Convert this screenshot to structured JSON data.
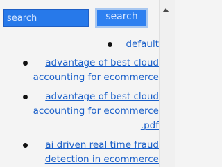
{
  "search": {
    "placeholder": "search",
    "button_label": "search"
  },
  "results": [
    {
      "text": "default"
    },
    {
      "text": "advantage of best cloud accounting for ecommerce"
    },
    {
      "text": "advantage of best cloud accounting for ecommerce .pdf"
    },
    {
      "text": "ai driven real time fraud detection in ecommerce"
    }
  ],
  "colors": {
    "input_bg": "#2779ea",
    "button_bg": "#2e80f0",
    "link": "#1a5fc9"
  }
}
